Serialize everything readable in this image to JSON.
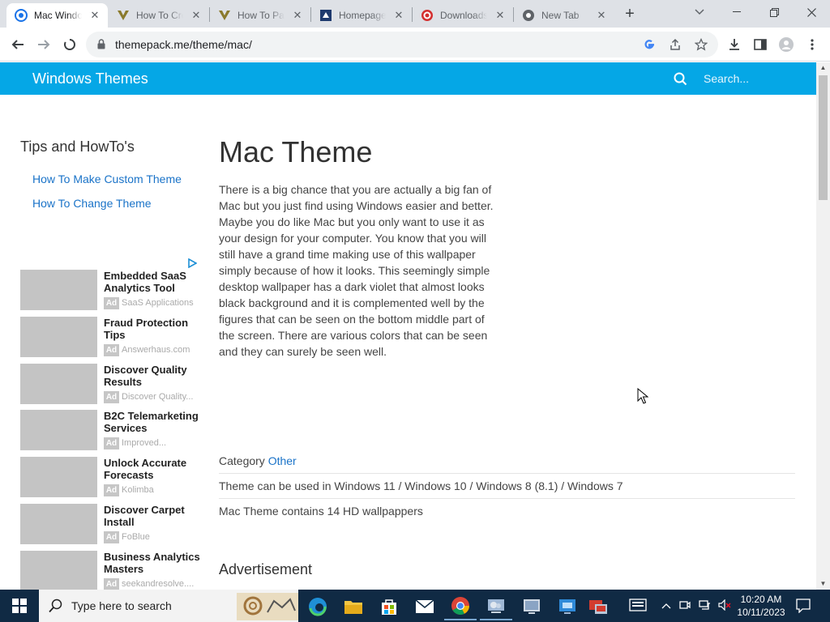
{
  "browser": {
    "tabs": [
      {
        "title": "Mac Windows Theme",
        "active": true
      },
      {
        "title": "How To Create Custom Theme",
        "active": false
      },
      {
        "title": "How To Pack Themes",
        "active": false
      },
      {
        "title": "Homepage",
        "active": false
      },
      {
        "title": "Downloads",
        "active": false
      },
      {
        "title": "New Tab",
        "active": false
      }
    ],
    "url": "themepack.me/theme/mac/"
  },
  "site": {
    "brand": "Windows Themes",
    "search_placeholder": "Search..."
  },
  "sidebar": {
    "title": "Tips and HowTo's",
    "links": [
      "How To Make Custom Theme",
      "How To Change Theme"
    ],
    "ads": [
      {
        "title": "Embedded SaaS Analytics Tool",
        "source": "SaaS Applications"
      },
      {
        "title": "Fraud Protection Tips",
        "source": "Answerhaus.com"
      },
      {
        "title": "Discover Quality Results",
        "source": "Discover Quality..."
      },
      {
        "title": "B2C Telemarketing Services",
        "source": "Improved..."
      },
      {
        "title": "Unlock Accurate Forecasts",
        "source": "Kolimba"
      },
      {
        "title": "Discover Carpet Install",
        "source": "FoBlue"
      },
      {
        "title": "Business Analytics Masters",
        "source": "seekandresolve...."
      }
    ],
    "ad_badge": "Ad"
  },
  "main": {
    "title": "Mac Theme",
    "description": "There is a big chance that you are actually a big fan of Mac but you just find using Windows easier and better. Maybe you do like Mac but you only want to use it as your design for your computer. You know that you will still have a grand time making use of this wallpaper simply because of how it looks. This seemingly simple desktop wallpaper has a dark violet that almost looks black background and it is complemented well by the figures that can be seen on the bottom middle part of the screen. There are various colors that can be seen and they can surely be seen well.",
    "category_label": "Category",
    "category_value": "Other",
    "compat": "Theme can be used in Windows 11 / Windows 10 / Windows 8 (8.1) / Windows 7",
    "contains": "Mac Theme contains 14 HD wallpappers",
    "advertisement_heading": "Advertisement"
  },
  "taskbar": {
    "search_placeholder": "Type here to search",
    "time": "10:20 AM",
    "date": "10/11/2023"
  },
  "colors": {
    "header": "#05a7e6",
    "link": "#1a73c8",
    "taskbar": "#102a44"
  }
}
